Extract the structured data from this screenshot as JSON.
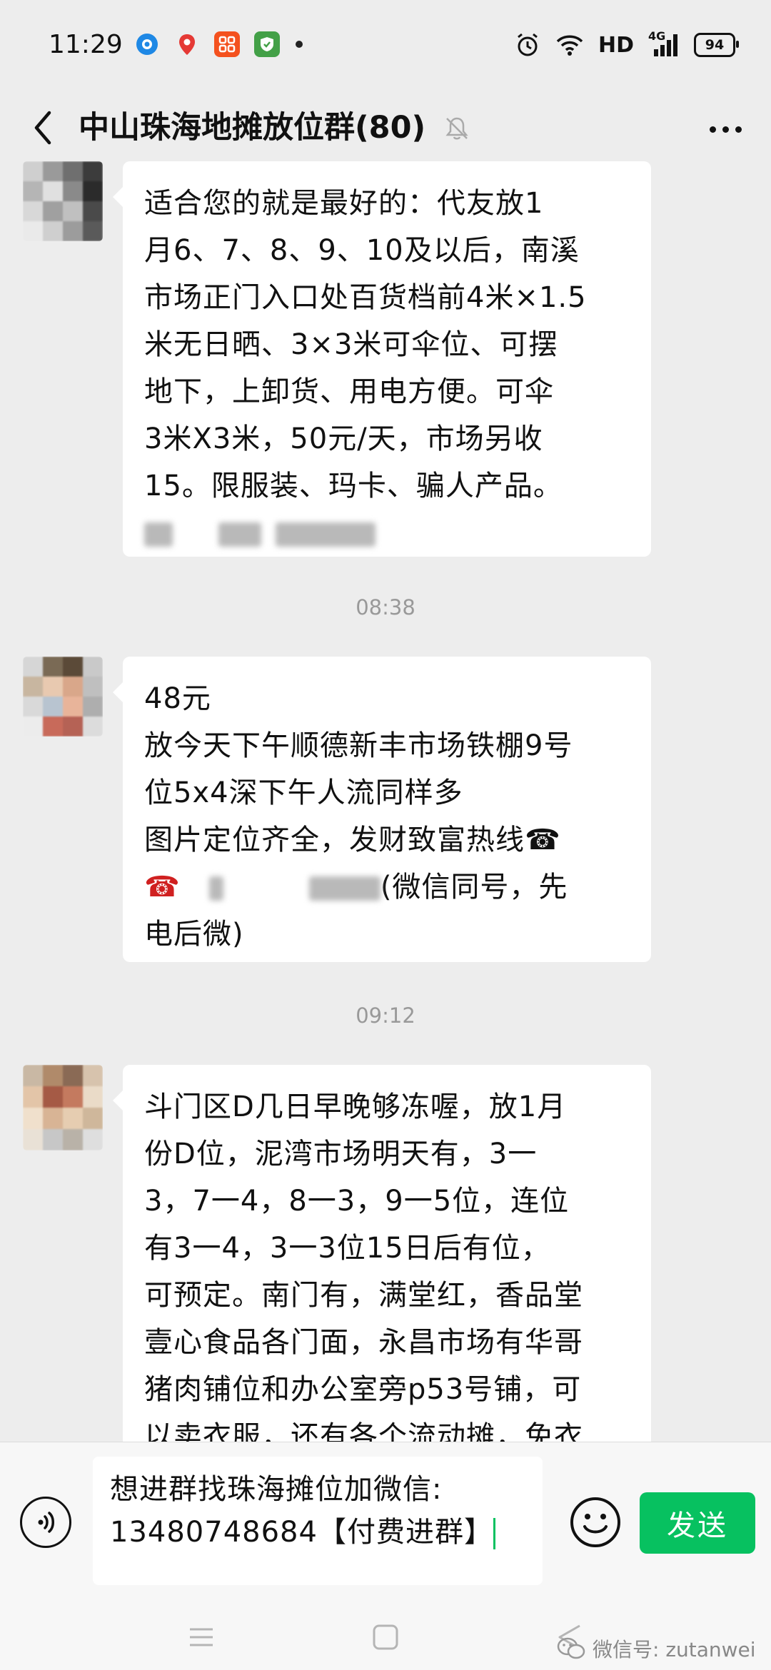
{
  "status_bar": {
    "time": "11:29",
    "network": "HD",
    "signal_label": "4G",
    "battery": "94"
  },
  "header": {
    "title": "中山珠海地摊放位群(80)"
  },
  "messages": [
    {
      "lines": [
        "适合您的就是最好的：代友放1",
        "月6、7、8、9、10及以后，南溪",
        "市场正门入口处百货档前4米×1.5",
        "米无日晒、3×3米可伞位、可摆",
        "地下，上卸货、用电方便。可伞",
        "3米X3米，50元/天，市场另收",
        "15。限服装、玛卡、骗人产品。"
      ]
    },
    {
      "lines": [
        "48元",
        "放今天下午顺德新丰市场铁棚9号",
        "位5x4深下午人流同样多",
        "图片定位齐全，发财致富热线☎"
      ],
      "tail_emoji": "☎",
      "tail_text": "(微信同号，先",
      "last_line": "电后微)"
    },
    {
      "lines": [
        "斗门区D几日早晚够冻喔，放1月",
        "份D位，泥湾市场明天有，3一",
        "3，7一4，8一3，9一5位，连位",
        "有3一4，3一3位15日后有位，",
        "可预定。南门有，满堂红，香品堂",
        "壹心食品各门面，永昌市场有华哥",
        "猪肉铺位和办公室旁p53号铺，可",
        "以卖衣服，还有各个流动摊，免衣"
      ]
    }
  ],
  "timestamps": [
    "08:38",
    "09:12"
  ],
  "input": {
    "value": "想进群找珠海摊位加微信:\n13480748684【付费进群】"
  },
  "send_label": "发送",
  "watermark": "微信号: zutanwei",
  "colors": {
    "accent": "#07c160",
    "background": "#ededed",
    "bubble": "#ffffff"
  }
}
